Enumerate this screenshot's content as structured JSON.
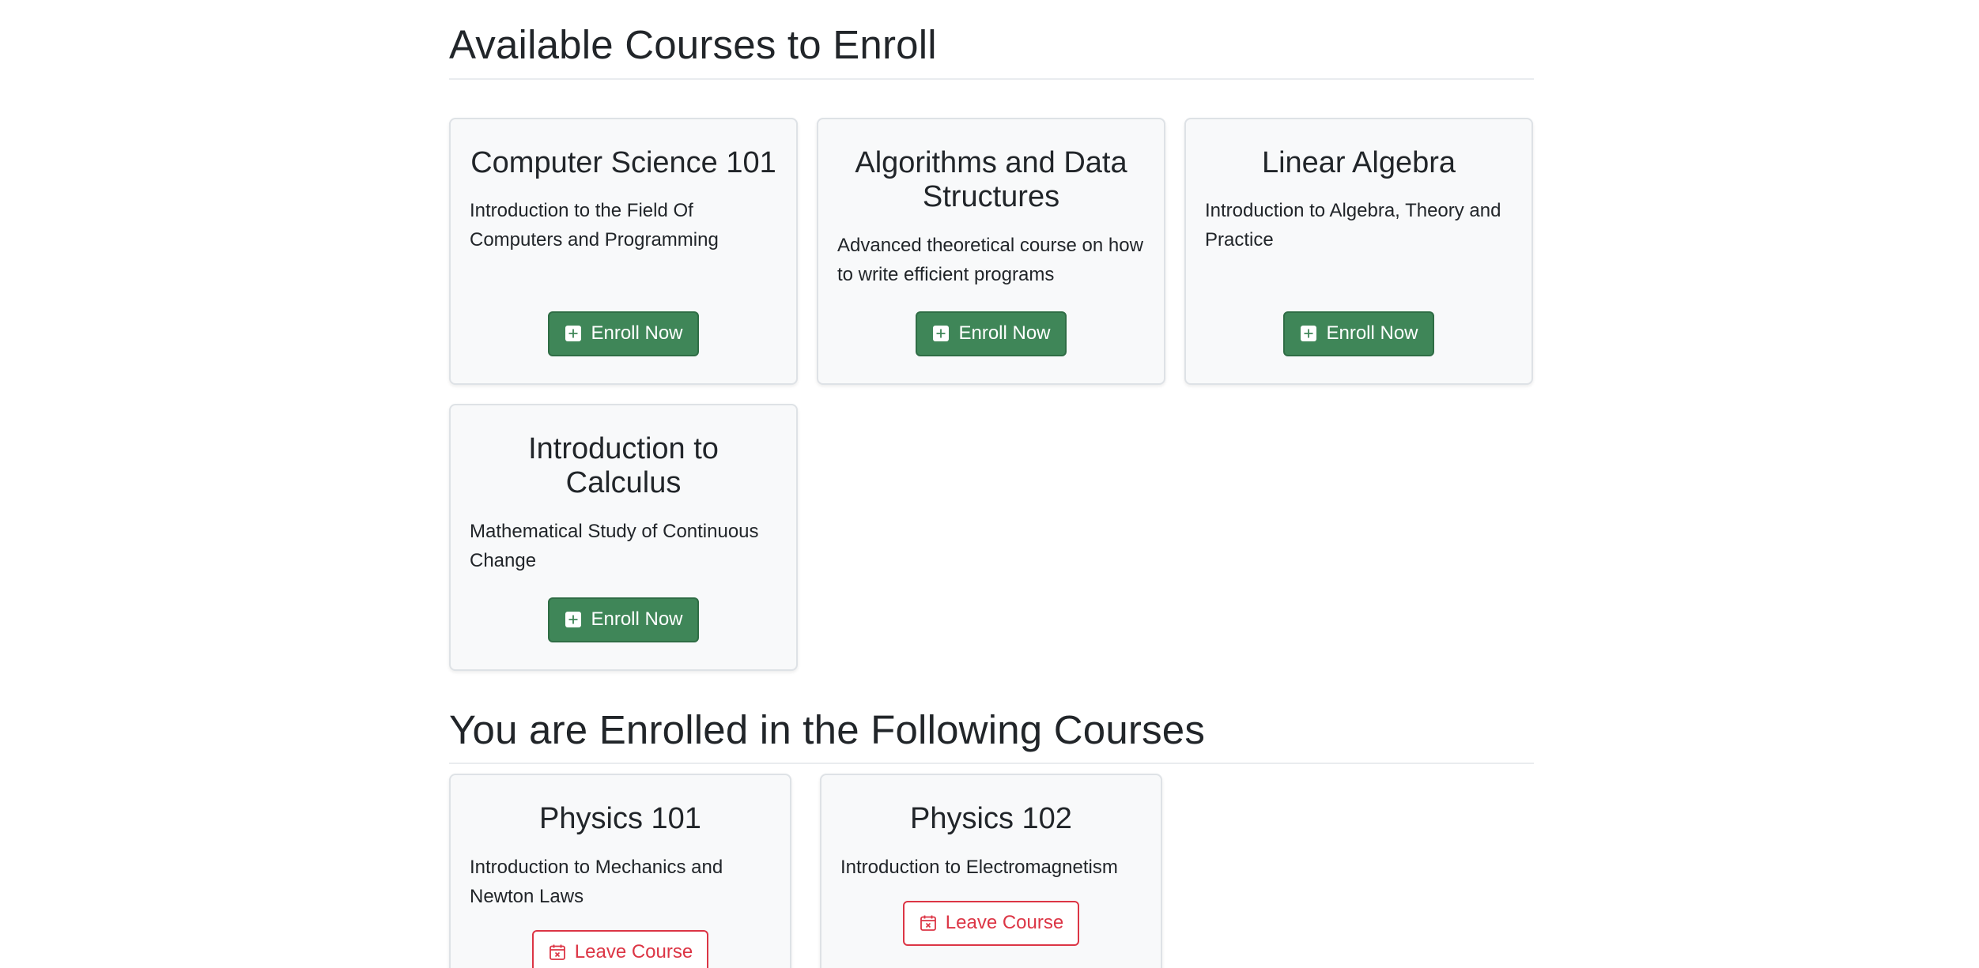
{
  "available": {
    "title": "Available Courses to Enroll",
    "courses": [
      {
        "title": "Computer Science 101",
        "description": "Introduction to the Field Of Computers and Programming",
        "button_label": "Enroll Now"
      },
      {
        "title": "Algorithms and Data Structures",
        "description": "Advanced theoretical course on how to write efficient programs",
        "button_label": "Enroll Now"
      },
      {
        "title": "Linear Algebra",
        "description": "Introduction to Algebra, Theory and Practice",
        "button_label": "Enroll Now"
      },
      {
        "title": "Introduction to Calculus",
        "description": "Mathematical Study of Continuous Change",
        "button_label": "Enroll Now"
      }
    ]
  },
  "enrolled": {
    "title": "You are Enrolled in the Following Courses",
    "courses": [
      {
        "title": "Physics 101",
        "description": "Introduction to Mechanics and Newton Laws",
        "button_label": "Leave Course"
      },
      {
        "title": "Physics 102",
        "description": "Introduction to Electromagnetism",
        "button_label": "Leave Course"
      }
    ]
  },
  "icons": {
    "enroll": "plus-square-icon",
    "leave": "calendar-x-icon"
  },
  "colors": {
    "enroll_button": "#3f8658",
    "leave_button": "#dc3545",
    "card_background": "#f8f9fa"
  }
}
